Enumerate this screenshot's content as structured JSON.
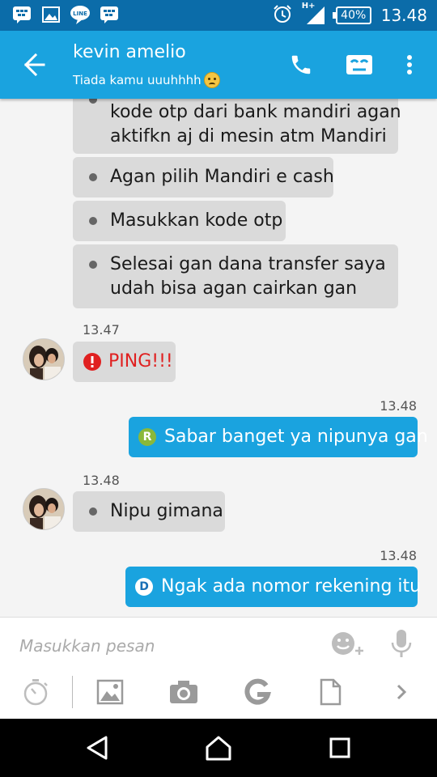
{
  "status_bar": {
    "notification_icons": [
      "bbm-icon",
      "gallery-icon",
      "line-icon",
      "bbm-icon"
    ],
    "network": "H+",
    "battery": "40%",
    "time": "13.48"
  },
  "header": {
    "contact_name": "kevin amelio",
    "status_message": "Tiada kamu uuuhhhh",
    "status_emoji": "sad-face-emoji",
    "accent_color": "#1aa3df"
  },
  "messages": [
    {
      "direction": "in",
      "lines": [
        "kode otp dari bank mandiri agan",
        "aktifkn aj di mesin atm Mandiri"
      ]
    },
    {
      "direction": "in",
      "lines": [
        "Agan pilih Mandiri e cash"
      ]
    },
    {
      "direction": "in",
      "lines": [
        "Masukkan kode otp"
      ]
    },
    {
      "direction": "in",
      "lines": [
        "Selesai gan dana transfer saya",
        "udah bisa agan cairkan gan"
      ]
    },
    {
      "direction": "in",
      "timestamp": "13.47",
      "lines": [
        "PING!!!"
      ],
      "type": "ping",
      "ping_color": "#e02020"
    },
    {
      "direction": "out",
      "timestamp": "13.48",
      "status_badge": "R",
      "lines": [
        "Sabar banget ya nipunya gan"
      ]
    },
    {
      "direction": "in",
      "timestamp": "13.48",
      "lines": [
        "Nipu gimana"
      ]
    },
    {
      "direction": "out",
      "timestamp": "13.48",
      "status_badge": "D",
      "lines": [
        "Ngak ada nomor rekening itu"
      ]
    }
  ],
  "input": {
    "placeholder": "Masukkan pesan",
    "value": ""
  },
  "toolbar_icons": [
    "timer-icon",
    "image-icon",
    "camera-icon",
    "google-icon",
    "document-icon",
    "chevron-right-icon"
  ],
  "nav_icons": [
    "back-triangle-icon",
    "home-icon",
    "recents-icon"
  ]
}
